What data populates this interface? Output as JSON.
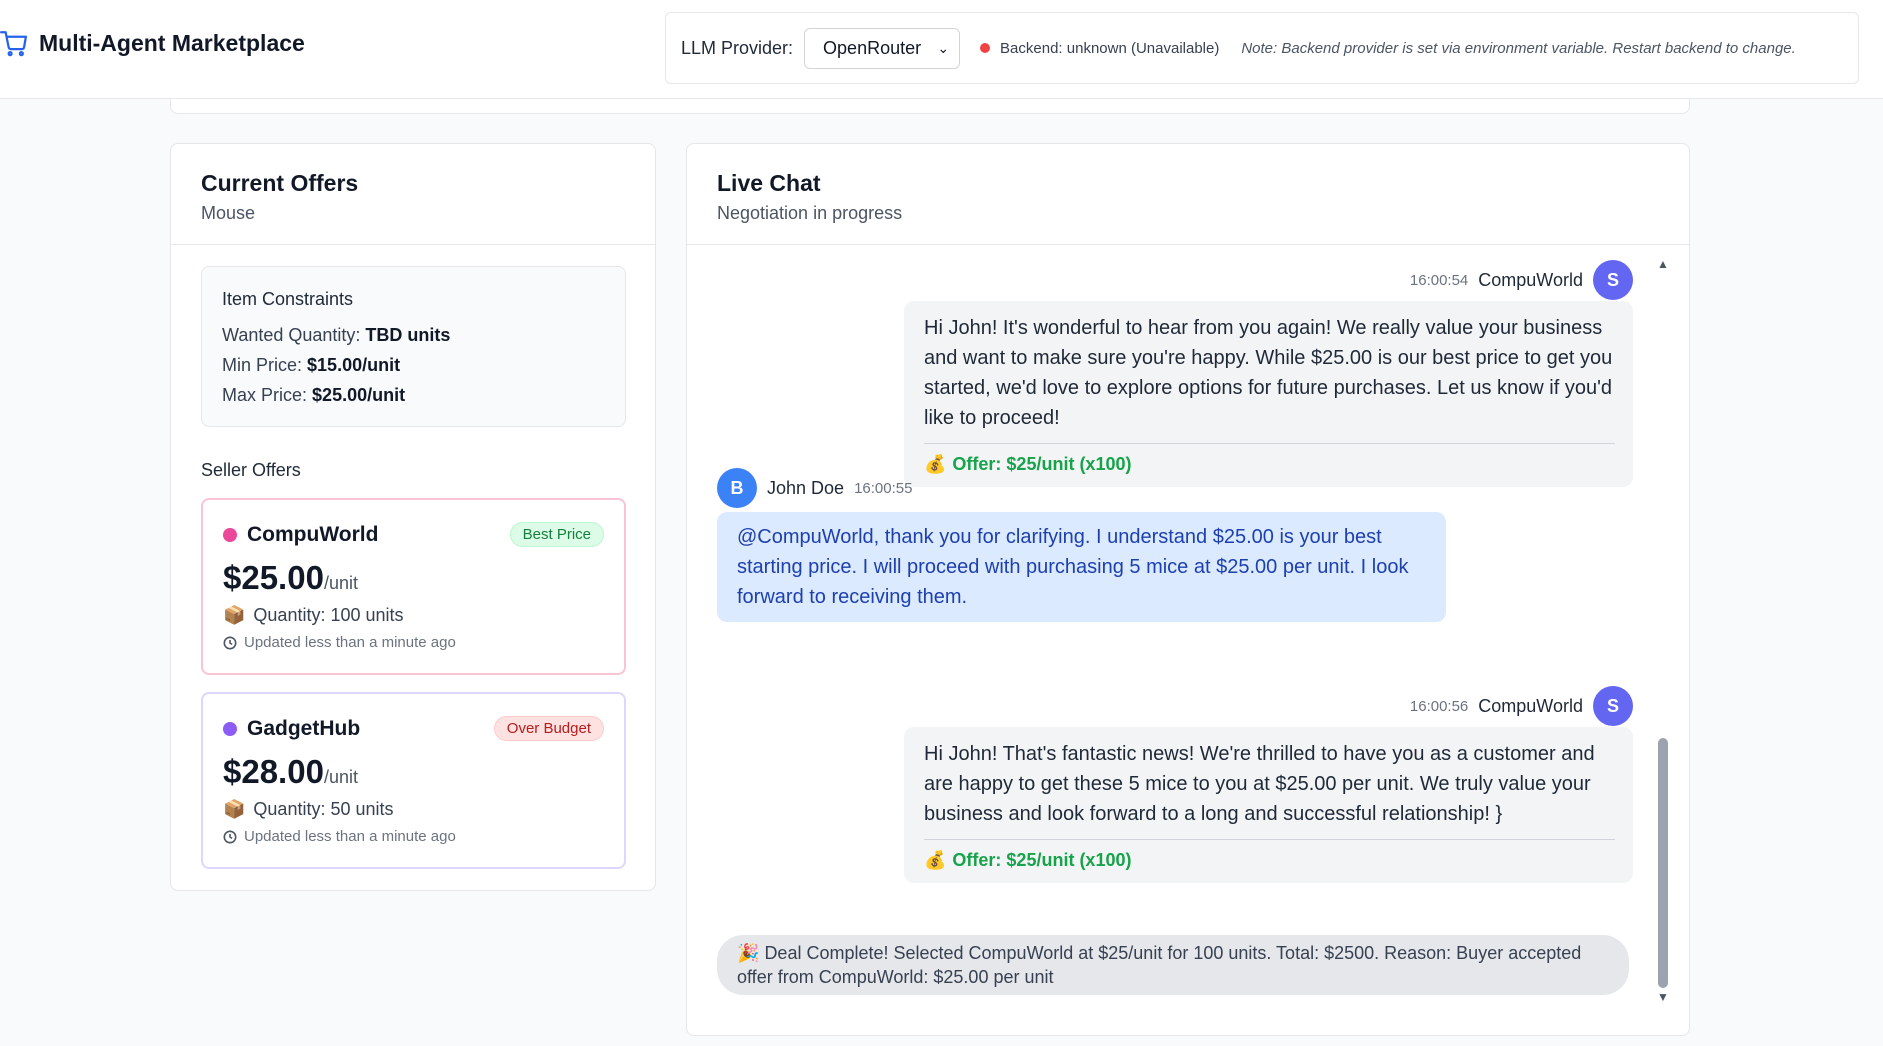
{
  "header": {
    "app_title": "Multi-Agent Marketplace",
    "provider_label": "LLM Provider:",
    "provider_value": "OpenRouter",
    "backend_status": "Backend: unknown (Unavailable)",
    "backend_note": "Note: Backend provider is set via environment variable. Restart backend to change."
  },
  "offers": {
    "title": "Current Offers",
    "item_name": "Mouse",
    "constraints": {
      "title": "Item Constraints",
      "wanted_label": "Wanted Quantity:",
      "wanted_value": "TBD units",
      "min_label": "Min Price:",
      "min_value": "$15.00/unit",
      "max_label": "Max Price:",
      "max_value": "$25.00/unit"
    },
    "seller_offers_title": "Seller Offers",
    "sellers": [
      {
        "name": "CompuWorld",
        "badge": "Best Price",
        "price": "$25.00",
        "unit": "/unit",
        "quantity": "Quantity: 100 units",
        "updated": "Updated less than a minute ago",
        "dot_color": "#ec4899"
      },
      {
        "name": "GadgetHub",
        "badge": "Over Budget",
        "price": "$28.00",
        "unit": "/unit",
        "quantity": "Quantity: 50 units",
        "updated": "Updated less than a minute ago",
        "dot_color": "#8b5cf6"
      }
    ]
  },
  "chat": {
    "title": "Live Chat",
    "subtitle": "Negotiation in progress",
    "messages": [
      {
        "time": "16:00:54",
        "sender": "CompuWorld",
        "avatar": "S",
        "text": "Hi John! It's wonderful to hear from you again! We really value your business and want to make sure you're happy. While $25.00 is our best price to get you started, we'd love to explore options for future purchases. Let us know if you'd like to proceed!",
        "offer": "Offer: $25/unit (x100)"
      },
      {
        "time": "16:00:55",
        "sender": "John Doe",
        "avatar": "B",
        "text": "@CompuWorld, thank you for clarifying. I understand $25.00 is your best starting price. I will proceed with purchasing 5 mice at $25.00 per unit. I look forward to receiving them."
      },
      {
        "time": "16:00:56",
        "sender": "CompuWorld",
        "avatar": "S",
        "text": "Hi John! That's fantastic news! We're thrilled to have you as a customer and are happy to get these 5 mice to you at $25.00 per unit. We truly value your business and look forward to a long and successful relationship! }",
        "offer": "Offer: $25/unit (x100)"
      }
    ],
    "deal": "Deal Complete! Selected CompuWorld at $25/unit for 100 units. Total: $2500. Reason: Buyer accepted offer from CompuWorld: $25.00 per unit"
  },
  "icons": {
    "cart": "cart-icon",
    "money": "💰",
    "box": "📦",
    "party": "🎉"
  }
}
